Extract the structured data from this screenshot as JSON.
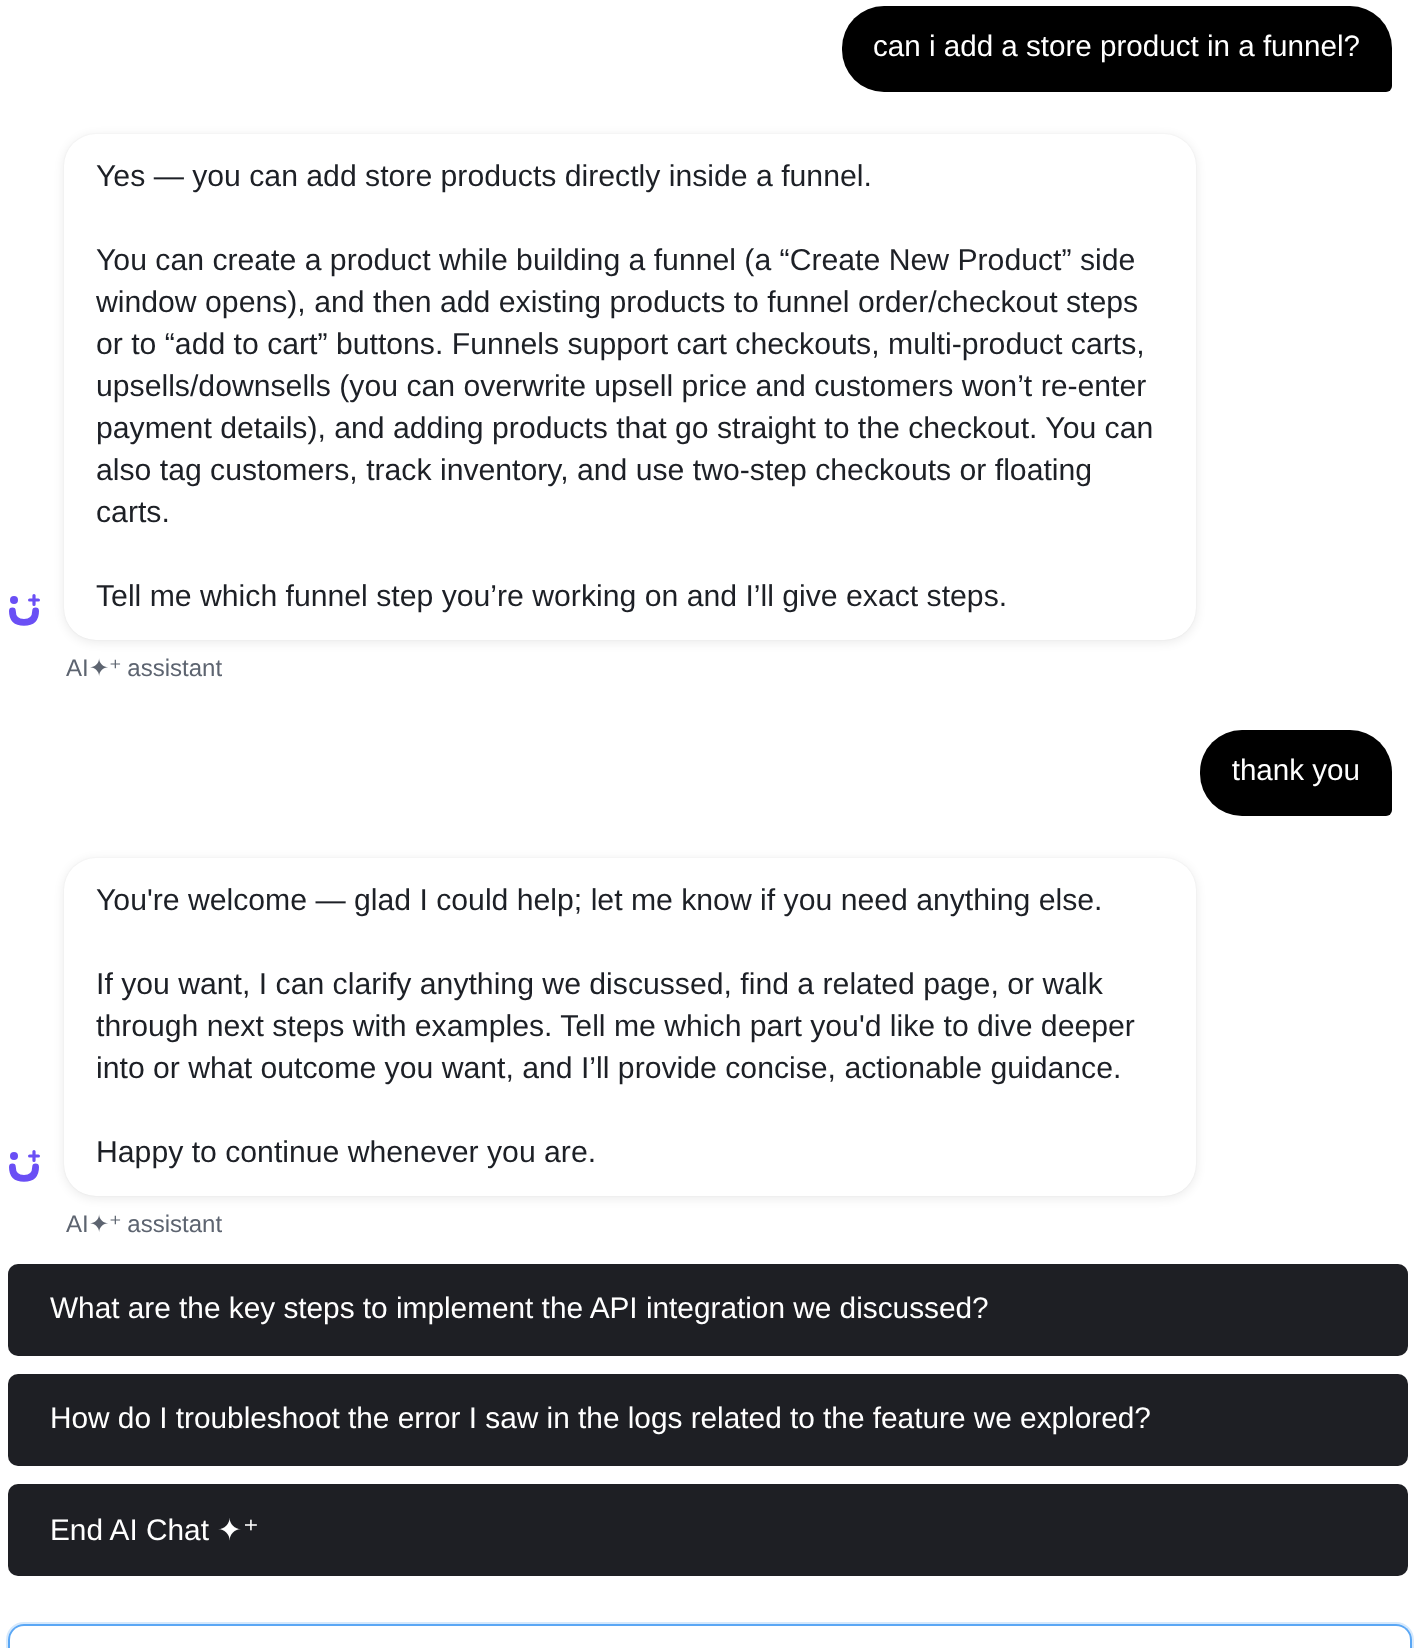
{
  "messages": [
    {
      "kind": "user",
      "text": "can i add a store product in a funnel?"
    },
    {
      "kind": "assistant",
      "paragraphs": [
        "Yes — you can add store products directly inside a funnel.",
        "You can create a product while building a funnel (a “Create New Product” side window opens), and then add existing products to funnel order/checkout steps or to “add to cart” buttons. Funnels support cart checkouts, multi-product carts, upsells/downsells (you can overwrite upsell price and customers won’t re-enter payment details), and adding products that go straight to the checkout. You can also tag customers, track inventory, and use two-step checkouts or floating carts.",
        "Tell me which funnel step you’re working on and I’ll give exact steps."
      ],
      "label": "AI✦⁺ assistant"
    },
    {
      "kind": "user",
      "text": "thank you"
    },
    {
      "kind": "assistant",
      "paragraphs": [
        "You're welcome — glad I could help; let me know if you need anything else.",
        "If you want, I can clarify anything we discussed, find a related page, or walk through next steps with examples. Tell me which part you'd like to dive deeper into or what outcome you want, and I’ll provide concise, actionable guidance.",
        "Happy to continue whenever you are."
      ],
      "label": "AI✦⁺ assistant"
    }
  ],
  "suggestions": [
    "What are the key steps to implement the API integration we discussed?",
    "How do I troubleshoot the error I saw in the logs related to the feature we explored?",
    "End AI Chat ✦⁺"
  ]
}
